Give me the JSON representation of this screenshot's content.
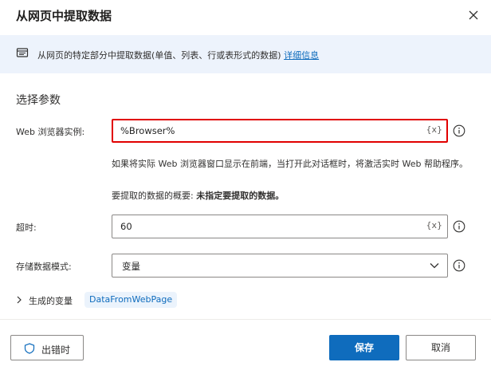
{
  "dialog": {
    "title": "从网页中提取数据",
    "close_icon": "close-icon"
  },
  "banner": {
    "text": "从网页的特定部分中提取数据(单值、列表、行或表形式的数据)",
    "link_text": "详细信息",
    "icon": "document-icon"
  },
  "section_title": "选择参数",
  "browser": {
    "label": "Web 浏览器实例:",
    "value": "%Browser%",
    "var_symbol": "{x}",
    "help_text": "如果将实际 Web 浏览器窗口显示在前端，当打开此对话框时，将激活实时 Web 帮助程序。",
    "summary_label": "要提取的数据的概要:",
    "summary_value": "未指定要提取的数据。"
  },
  "timeout": {
    "label": "超时:",
    "value": "60",
    "var_symbol": "{x}"
  },
  "storage_mode": {
    "label": "存储数据模式:",
    "selected": "变量"
  },
  "generated_vars": {
    "label": "生成的变量",
    "variable": "DataFromWebPage"
  },
  "footer": {
    "on_error_label": "出错时",
    "save_label": "保存",
    "cancel_label": "取消"
  },
  "colors": {
    "accent": "#0f6cbd",
    "highlight_border": "#e10000",
    "banner_bg": "#edf3fc"
  }
}
